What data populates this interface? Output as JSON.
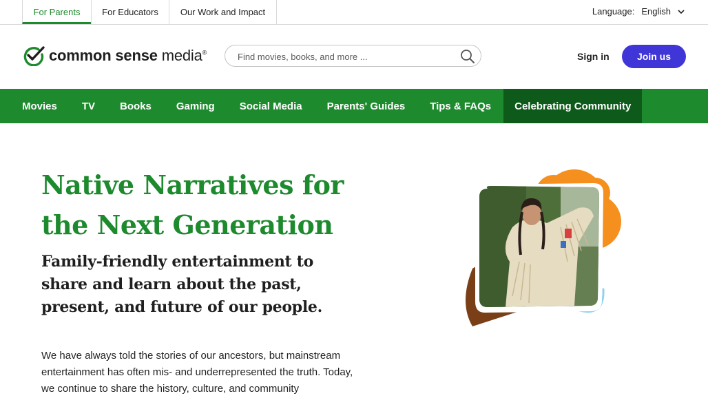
{
  "topbar": {
    "tabs": [
      {
        "label": "For Parents",
        "active": true
      },
      {
        "label": "For Educators",
        "active": false
      },
      {
        "label": "Our Work and Impact",
        "active": false
      }
    ],
    "language_label": "Language:",
    "language_value": "English",
    "language_icon": "chevron-down-icon"
  },
  "header": {
    "logo_word1": "common sense",
    "logo_word2": "media",
    "logo_mark": "reg",
    "search_placeholder": "Find movies, books, and more ...",
    "search_icon": "search-icon",
    "signin_label": "Sign in",
    "join_label": "Join us"
  },
  "nav": {
    "items": [
      {
        "label": "Movies"
      },
      {
        "label": "TV"
      },
      {
        "label": "Books"
      },
      {
        "label": "Gaming"
      },
      {
        "label": "Social Media"
      },
      {
        "label": "Parents' Guides"
      },
      {
        "label": "Tips & FAQs"
      },
      {
        "label": "Celebrating Community",
        "active": true
      }
    ]
  },
  "hero": {
    "title": "Native Narratives for the Next Generation",
    "subtitle": "Family-friendly entertainment to share and learn about the past, present, and future of our people.",
    "body": "We have always told the stories of our ancestors, but mainstream entertainment has often mis- and underrepresented the truth. Today, we continue to share the history, culture, and community"
  },
  "colors": {
    "brand_green": "#1e8a2e",
    "nav_active": "#0e5a1a",
    "join_purple": "#4035d6",
    "accent_orange": "#f5901e",
    "accent_brown": "#7a3f17",
    "accent_blue": "#8fd3f0"
  }
}
